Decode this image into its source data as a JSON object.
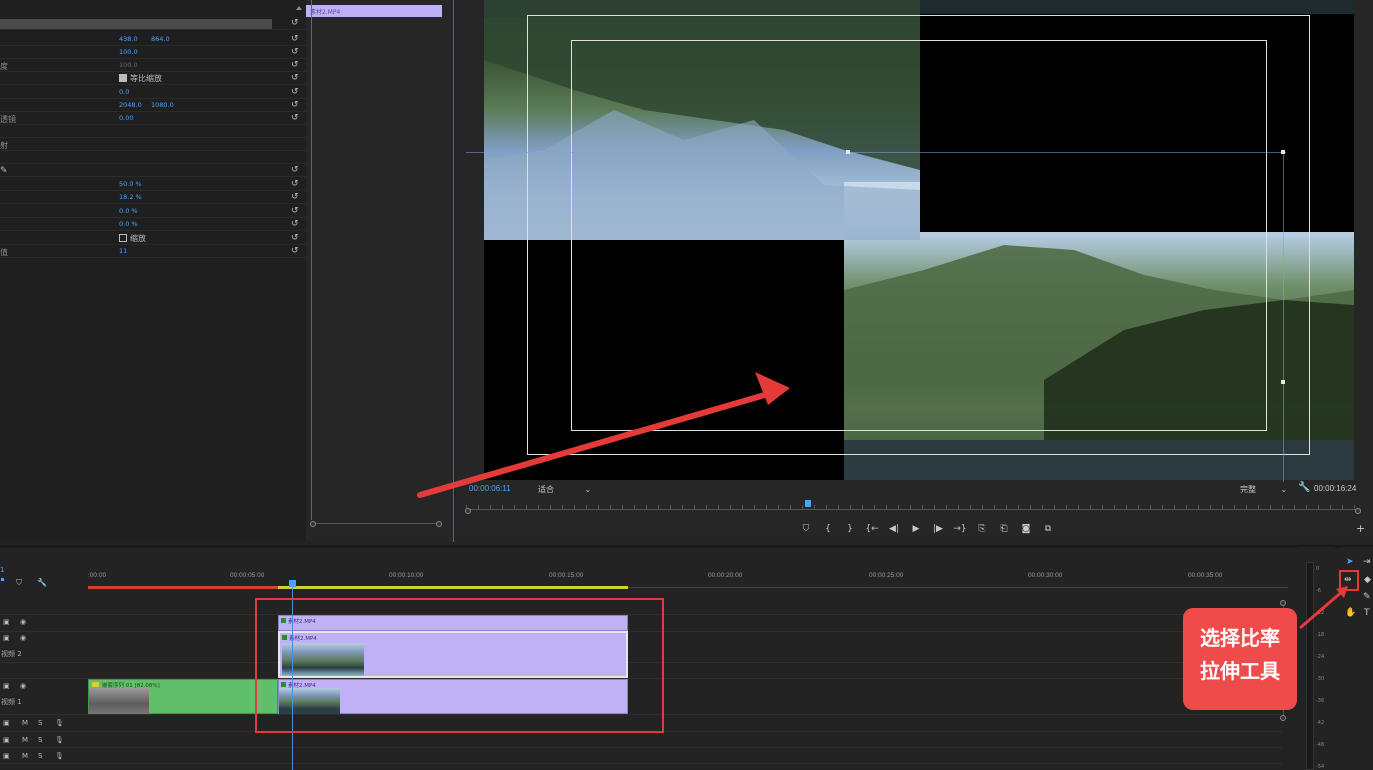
{
  "effect_controls": {
    "rows": [
      {
        "label": "",
        "value": "",
        "value2": "",
        "extra": ""
      },
      {
        "label": "",
        "value": "438.0",
        "value2": "864.0"
      },
      {
        "label": "",
        "value": "100.0",
        "value2": ""
      },
      {
        "label": "度",
        "value": "100.0",
        "value2": "",
        "dim": true
      },
      {
        "label": "",
        "checkbox_label": "等比缩放",
        "checked": true
      },
      {
        "label": "",
        "value": "0.0",
        "value2": ""
      },
      {
        "label": "",
        "value": "2048.0",
        "value2": "1080.0"
      },
      {
        "label": "透镜",
        "value": "0.00",
        "value2": ""
      },
      {
        "label": "",
        "value": "",
        "value2": ""
      },
      {
        "label": "射",
        "value": "",
        "value2": ""
      },
      {
        "label": "",
        "value": "",
        "value2": ""
      },
      {
        "label": "",
        "value": "",
        "value2": ""
      },
      {
        "label": "",
        "value": "50.0 %",
        "value2": ""
      },
      {
        "label": "",
        "value": "18.2 %",
        "value2": ""
      },
      {
        "label": "",
        "value": "0.0 %",
        "value2": ""
      },
      {
        "label": "",
        "value": "0.0 %",
        "value2": ""
      },
      {
        "label": "",
        "checkbox_label": "缩放",
        "checked": false
      },
      {
        "label": "值",
        "value": "11",
        "value2": ""
      }
    ],
    "clip_name": "素材2.MP4"
  },
  "monitor": {
    "current_timecode": "00:00:06:11",
    "zoom_label": "适合",
    "quality_label": "完整",
    "duration_timecode": "00:00:16:24",
    "transport_icons": [
      "marker-icon",
      "mark-in-icon",
      "mark-out-icon",
      "go-to-in-icon",
      "step-back-icon",
      "play-icon",
      "step-forward-icon",
      "go-to-out-icon",
      "lift-icon",
      "extract-icon",
      "export-frame-icon",
      "comparison-view-icon"
    ],
    "transport_glyphs": [
      "⛉",
      "{",
      "}",
      "{←",
      "◀|",
      "▶",
      "|▶",
      "→}",
      "⎘",
      "⎗",
      "◙",
      "⧉"
    ],
    "add_label": "+"
  },
  "timeline": {
    "ruler_labels": [
      ":00:00",
      "00:00:05:00",
      "00:00:10:00",
      "00:00:15:00",
      "00:00:20:00",
      "00:00:25:00",
      "00:00:30:00",
      "00:00:35:00"
    ],
    "header_num": "1",
    "track_names": {
      "v2": "视频 2",
      "v1": "视频 1"
    },
    "clips": {
      "v3_clip": "素材2.MP4",
      "v2_clip": "素材2.MP4",
      "v1_clip": "素材2.MP4",
      "green_clip": "嵌套序列 01 [82.08%]"
    },
    "audio_labels": {
      "m": "M",
      "s": "S"
    }
  },
  "meter": {
    "labels": [
      "0",
      "-6",
      "-12",
      "-18",
      "-24",
      "-30",
      "-36",
      "-42",
      "-48",
      "-54"
    ]
  },
  "callout": {
    "line1": "选择比率",
    "line2": "拉伸工具"
  },
  "colors": {
    "clip": "#c0b1f6",
    "accent": "#4aa3ff",
    "annotation": "#e53a3a"
  }
}
